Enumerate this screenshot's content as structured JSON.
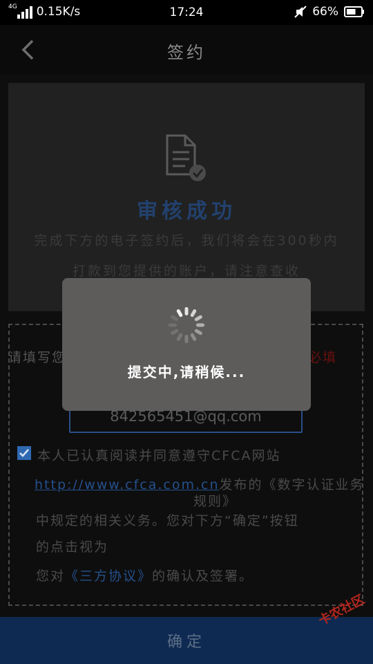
{
  "statusbar": {
    "network_type": "4G",
    "speed": "0.15K/s",
    "time": "17:24",
    "battery_percent": "66%",
    "battery_level": 0.66
  },
  "nav": {
    "title": "签约"
  },
  "card": {
    "title": "审核成功",
    "desc_line1": "完成下方的电子签约后，我们将会在300秒内",
    "desc_line2": "打款到您提供的账户，请注意查收"
  },
  "form": {
    "fill_hint": "请填写您",
    "required": "必填",
    "email_value": "842565451@qq.com",
    "agree_line1": "本人已认真阅读并同意遵守CFCA网站",
    "agree_link": "http://www.cfca.com.cn",
    "agree_line2_rest": "发布的《数字认证业务",
    "agree_line2b": "规则》",
    "agree_line3": "中规定的相关义务。您对下方“确定”按钮",
    "agree_line4": "的点击视为",
    "agree_line5_pre": "您对",
    "agree_protocol": "《三方协议》",
    "agree_line5_post": "的确认及签署。"
  },
  "footer": {
    "confirm_label": "确定"
  },
  "dialog": {
    "loading_text": "提交中,请稍候..."
  },
  "watermark": {
    "text": "卡农社区"
  },
  "colors": {
    "accent": "#2f68b2",
    "confirm_bar": "#0e2a52",
    "dialog_bg": "#5e5c5b"
  }
}
